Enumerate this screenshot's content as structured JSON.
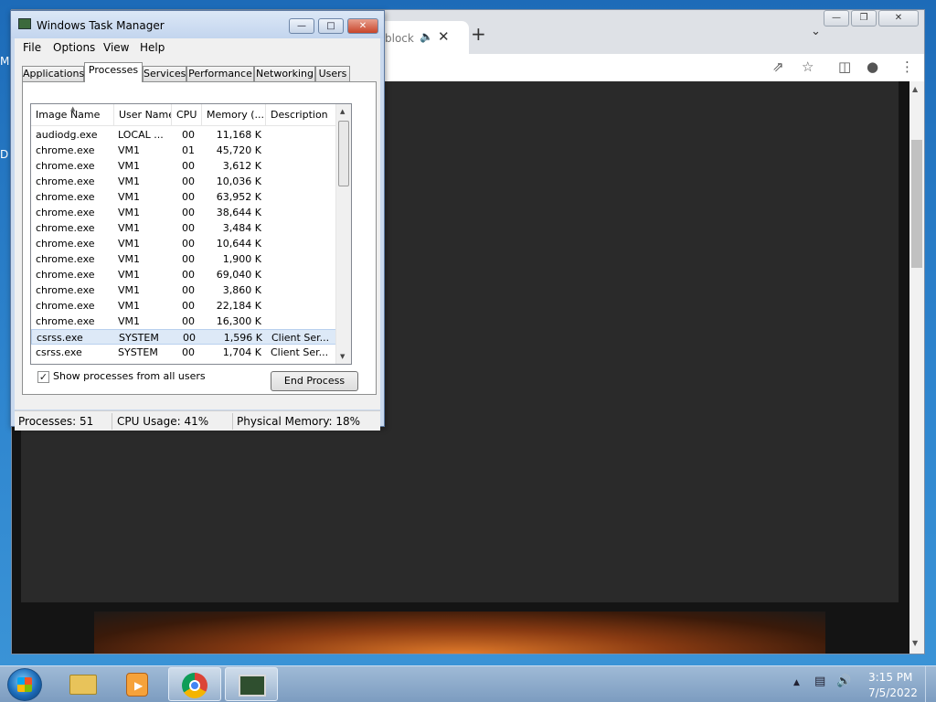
{
  "desktop": {
    "letter_m": "M",
    "letter_d": "D"
  },
  "chrome": {
    "tab_title": "block",
    "audio_icon": "speaker-icon",
    "close_glyph": "✕",
    "newtab_glyph": "+",
    "tab_list_glyph": "⌄",
    "win_minimize": "—",
    "win_maximize": "❐",
    "win_close": "✕",
    "toolbar_icons": [
      "share-icon",
      "star-icon",
      "side-panel-icon",
      "profile-icon",
      "menu-icon"
    ]
  },
  "task_manager": {
    "title": "Windows Task Manager",
    "menu": [
      "File",
      "Options",
      "View",
      "Help"
    ],
    "tabs": [
      "Applications",
      "Processes",
      "Services",
      "Performance",
      "Networking",
      "Users"
    ],
    "active_tab": "Processes",
    "columns": [
      "Image Name",
      "User Name",
      "CPU",
      "Memory (...",
      "Description"
    ],
    "processes": [
      {
        "name": "audiodg.exe",
        "user": "LOCAL ...",
        "cpu": "00",
        "mem": "11,168 K",
        "desc": ""
      },
      {
        "name": "chrome.exe",
        "user": "VM1",
        "cpu": "01",
        "mem": "45,720 K",
        "desc": ""
      },
      {
        "name": "chrome.exe",
        "user": "VM1",
        "cpu": "00",
        "mem": "3,612 K",
        "desc": ""
      },
      {
        "name": "chrome.exe",
        "user": "VM1",
        "cpu": "00",
        "mem": "10,036 K",
        "desc": ""
      },
      {
        "name": "chrome.exe",
        "user": "VM1",
        "cpu": "00",
        "mem": "63,952 K",
        "desc": ""
      },
      {
        "name": "chrome.exe",
        "user": "VM1",
        "cpu": "00",
        "mem": "38,644 K",
        "desc": ""
      },
      {
        "name": "chrome.exe",
        "user": "VM1",
        "cpu": "00",
        "mem": "3,484 K",
        "desc": ""
      },
      {
        "name": "chrome.exe",
        "user": "VM1",
        "cpu": "00",
        "mem": "10,644 K",
        "desc": ""
      },
      {
        "name": "chrome.exe",
        "user": "VM1",
        "cpu": "00",
        "mem": "1,900 K",
        "desc": ""
      },
      {
        "name": "chrome.exe",
        "user": "VM1",
        "cpu": "00",
        "mem": "69,040 K",
        "desc": ""
      },
      {
        "name": "chrome.exe",
        "user": "VM1",
        "cpu": "00",
        "mem": "3,860 K",
        "desc": ""
      },
      {
        "name": "chrome.exe",
        "user": "VM1",
        "cpu": "00",
        "mem": "22,184 K",
        "desc": ""
      },
      {
        "name": "chrome.exe",
        "user": "VM1",
        "cpu": "00",
        "mem": "16,300 K",
        "desc": ""
      },
      {
        "name": "csrss.exe",
        "user": "SYSTEM",
        "cpu": "00",
        "mem": "1,596 K",
        "desc": "Client Ser..."
      },
      {
        "name": "csrss.exe",
        "user": "SYSTEM",
        "cpu": "00",
        "mem": "1,704 K",
        "desc": "Client Ser..."
      }
    ],
    "selected_row": 13,
    "show_all_label": "Show processes from all users",
    "show_all_checked": true,
    "end_process_label": "End Process",
    "status": {
      "processes": "Processes: 51",
      "cpu": "CPU Usage: 41%",
      "memory": "Physical Memory: 18%"
    }
  },
  "taskbar": {
    "items": [
      "start-button",
      "explorer-icon",
      "media-player-icon",
      "chrome-icon",
      "task-manager-icon"
    ],
    "time": "3:15 PM",
    "date": "7/5/2022"
  }
}
